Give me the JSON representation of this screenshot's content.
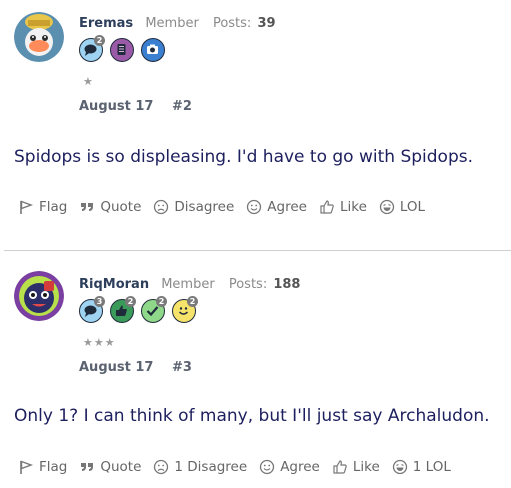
{
  "posts": [
    {
      "username": "Eremas",
      "role": "Member",
      "posts_label": "Posts:",
      "posts_count": "39",
      "stars": "★",
      "badges": [
        {
          "icon": "chat-bubble-icon",
          "count": "2",
          "color": "#9fd3f2"
        },
        {
          "icon": "notebook-icon",
          "count": "",
          "color": "#9b5aa8"
        },
        {
          "icon": "camera-icon",
          "count": "",
          "color": "#3b7fd0"
        }
      ],
      "date": "August 17",
      "post_number": "#2",
      "body": "Spidops is so displeasing. I'd have to go with Spidops.",
      "actions": {
        "flag": "Flag",
        "quote": "Quote",
        "disagree": "Disagree",
        "agree": "Agree",
        "like": "Like",
        "lol": "LOL"
      }
    },
    {
      "username": "RiqMoran",
      "role": "Member",
      "posts_label": "Posts:",
      "posts_count": "188",
      "stars": "★★★",
      "badges": [
        {
          "icon": "chat-bubble-icon",
          "count": "3",
          "color": "#9fd3f2"
        },
        {
          "icon": "thumbs-up-icon",
          "count": "2",
          "color": "#3a9a5a"
        },
        {
          "icon": "checkmark-icon",
          "count": "2",
          "color": "#8fd88a"
        },
        {
          "icon": "smiley-icon",
          "count": "2",
          "color": "#f5e36a"
        }
      ],
      "date": "August 17",
      "post_number": "#3",
      "body": "Only 1? I can think of many, but I'll just say Archaludon.",
      "actions": {
        "flag": "Flag",
        "quote": "Quote",
        "disagree": "1 Disagree",
        "agree": "Agree",
        "like": "Like",
        "lol": "1 LOL"
      }
    }
  ]
}
